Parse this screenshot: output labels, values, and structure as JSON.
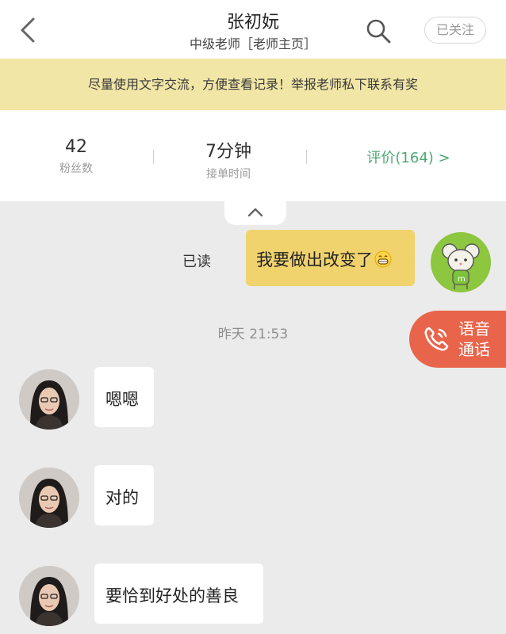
{
  "header": {
    "title": "张初妧",
    "subtitle": "中级老师［老师主页］",
    "follow_label": "已关注"
  },
  "notice": "尽量使用文字交流，方便查看记录！举报老师私下联系有奖",
  "stats": {
    "fans_count": "42",
    "fans_label": "粉丝数",
    "response_time": "7分钟",
    "response_label": "接单时间",
    "rating_label": "评价(164) >"
  },
  "chat": {
    "read_status": "已读",
    "my_message": "我要做出改变了",
    "timestamp": "昨天 21:53",
    "teacher_messages": [
      "嗯嗯",
      "对的",
      "要恰到好处的善良"
    ]
  },
  "voice_call": {
    "line1": "语音",
    "line2": "通话"
  },
  "colors": {
    "accent_green": "#4fa874",
    "notice_bg": "#f1e6a6",
    "my_bubble": "#f1d36d",
    "voice_button": "#e8644a"
  }
}
